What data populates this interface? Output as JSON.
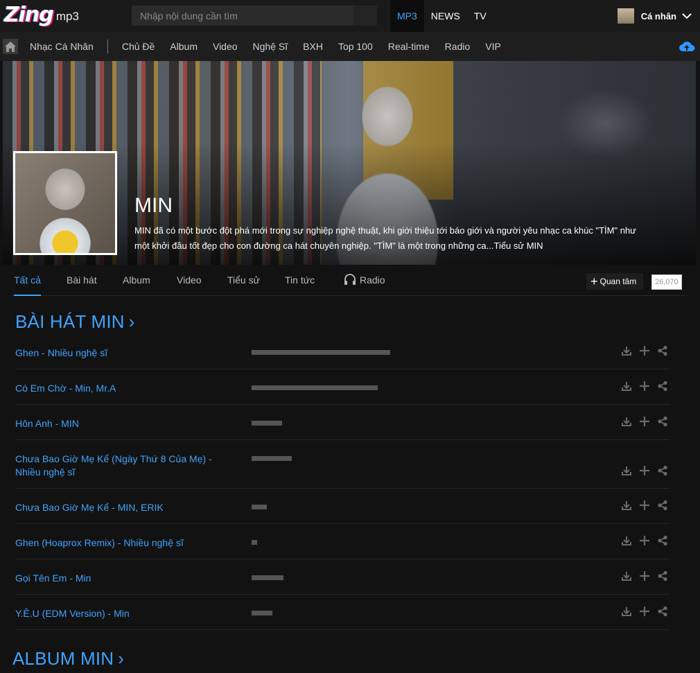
{
  "header": {
    "logo": "Zing",
    "logo_suffix": "mp3",
    "search_placeholder": "Nhập nội dung cần tìm",
    "top_nav": [
      "MP3",
      "NEWS",
      "TV"
    ],
    "user_label": "Cá nhân"
  },
  "subnav": {
    "first": "Nhạc Cá Nhân",
    "items": [
      "Chủ Đề",
      "Album",
      "Video",
      "Nghệ Sĩ",
      "BXH",
      "Top 100",
      "Real-time",
      "Radio",
      "VIP"
    ]
  },
  "artist": {
    "name": "MIN",
    "bio_line1": "MIN đã có một bước đột phá mới trong sự nghiệp nghệ thuật, khi giới thiệu tới báo giới và người yêu nhạc ca khúc \"TÌM\" như",
    "bio_line2": "một khởi đầu tốt đẹp cho con đường ca hát chuyên nghiệp. \"TÌM\" là một trong những ca...",
    "bio_link": "Tiểu sử MIN"
  },
  "tabs": [
    "Tất cả",
    "Bài hát",
    "Album",
    "Video",
    "Tiểu sử",
    "Tin tức",
    "Radio"
  ],
  "follow": {
    "label": "Quan tâm",
    "count": "26,070"
  },
  "songs_section": {
    "title": "BÀI HÁT MIN",
    "chevron": "›"
  },
  "songs": [
    {
      "title": "Ghen",
      "artist": "Nhiều nghệ sĩ",
      "popularity": 1.0
    },
    {
      "title": "Có Em Chờ",
      "artist": "Min, Mr.A",
      "popularity": 0.91
    },
    {
      "title": "Hôn Anh",
      "artist": "MIN",
      "popularity": 0.22
    },
    {
      "title": "Chưa Bao Giờ Mẹ Kể (Ngày Thứ 8 Của Mẹ)",
      "artist": "Nhiều nghệ sĩ",
      "popularity": 0.29
    },
    {
      "title": "Chưa Bao Giờ Mẹ Kể",
      "artist": "MIN, ERIK",
      "popularity": 0.11
    },
    {
      "title": "Ghen (Hoaprox Remix)",
      "artist": "Nhiều nghệ sĩ",
      "popularity": 0.04
    },
    {
      "title": "Gọi Tên Em",
      "artist": "Min",
      "popularity": 0.23
    },
    {
      "title": "Y.Ê.U (EDM Version)",
      "artist": "Min",
      "popularity": 0.15
    }
  ],
  "album_section": {
    "title": "ALBUM MIN",
    "chevron": "›"
  },
  "icons": {
    "home": "home-icon",
    "upload": "cloud-upload-icon",
    "radio": "headphones-icon",
    "download": "download-icon",
    "add": "plus-icon",
    "share": "share-icon"
  },
  "colors": {
    "accent": "#3fa4ff",
    "background": "#121212",
    "bar": "#555555"
  }
}
